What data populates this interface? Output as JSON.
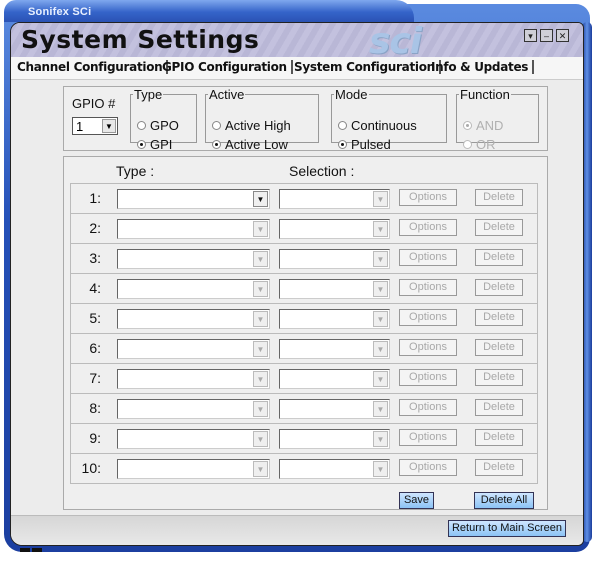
{
  "app": {
    "title": "Sonifex SCi",
    "header_title": "System Settings",
    "logo_text": "sci",
    "window_buttons": [
      "restore-icon",
      "minimize-icon",
      "close-icon"
    ]
  },
  "tabs": [
    {
      "label": "Channel Configuration",
      "active": false
    },
    {
      "label": "GPIO Configuration",
      "active": true
    },
    {
      "label": "System Configuration",
      "active": false
    },
    {
      "label": "Info & Updates",
      "active": false
    }
  ],
  "gpio": {
    "label": "GPIO #",
    "selected": "1"
  },
  "groups": {
    "type": {
      "legend": "Type",
      "options": [
        "GPO",
        "GPI"
      ],
      "selected": "GPI"
    },
    "active": {
      "legend": "Active",
      "options": [
        "Active High",
        "Active Low"
      ],
      "selected": "Active Low"
    },
    "mode": {
      "legend": "Mode",
      "options": [
        "Continuous",
        "Pulsed"
      ],
      "selected": "Pulsed"
    },
    "function": {
      "legend": "Function",
      "options": [
        "AND",
        "OR"
      ],
      "selected": "AND",
      "disabled": true
    }
  },
  "table": {
    "col_type": "Type :",
    "col_selection": "Selection :",
    "rows": [
      {
        "num": "1:",
        "type": "",
        "selection": ""
      },
      {
        "num": "2:",
        "type": "",
        "selection": ""
      },
      {
        "num": "3:",
        "type": "",
        "selection": ""
      },
      {
        "num": "4:",
        "type": "",
        "selection": ""
      },
      {
        "num": "5:",
        "type": "",
        "selection": ""
      },
      {
        "num": "6:",
        "type": "",
        "selection": ""
      },
      {
        "num": "7:",
        "type": "",
        "selection": ""
      },
      {
        "num": "8:",
        "type": "",
        "selection": ""
      },
      {
        "num": "9:",
        "type": "",
        "selection": ""
      },
      {
        "num": "10:",
        "type": "",
        "selection": ""
      }
    ],
    "options_label": "Options",
    "delete_label": "Delete"
  },
  "actions": {
    "save": "Save",
    "delete_all": "Delete All",
    "return": "Return to Main Screen"
  },
  "colors": {
    "frame_blue": "#2450b8",
    "header_lavender": "#bdbbd9",
    "button_blue": "#a8d2fa"
  }
}
